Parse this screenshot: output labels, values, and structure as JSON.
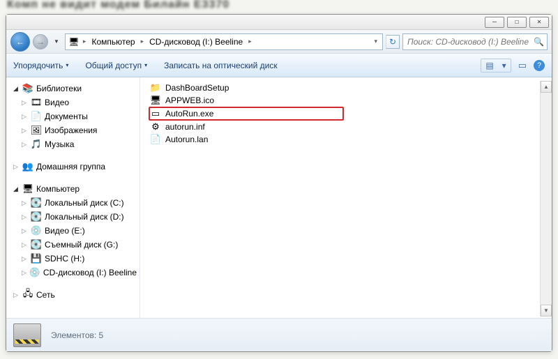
{
  "window_buttons": {
    "min": "—",
    "max": "☐",
    "close": "✕"
  },
  "nav": {
    "back_glyph": "←",
    "fwd_glyph": "→",
    "drop": "▼"
  },
  "breadcrumbs": {
    "root_icon": "🖥",
    "sep": "▸",
    "items": [
      "Компьютер",
      "CD-дисковод (I:) Beeline"
    ],
    "addr_drop": "▾",
    "refresh": "↻"
  },
  "search": {
    "placeholder": "Поиск: CD-дисковод (I:) Beeline",
    "icon": "🔍"
  },
  "toolbar": {
    "organize": "Упорядочить",
    "share": "Общий доступ",
    "burn": "Записать на оптический диск",
    "drop": "▾",
    "view_icon": "▤",
    "pane_icon": "▭",
    "help": "?"
  },
  "sidebar": {
    "libraries": {
      "label": "Библиотеки",
      "expander": "◢",
      "items": [
        {
          "icon": "🎞",
          "label": "Видео"
        },
        {
          "icon": "📄",
          "label": "Документы"
        },
        {
          "icon": "🖼",
          "label": "Изображения"
        },
        {
          "icon": "🎵",
          "label": "Музыка"
        }
      ]
    },
    "homegroup": {
      "label": "Домашняя группа",
      "icon": "👥"
    },
    "computer": {
      "label": "Компьютер",
      "expander": "◢",
      "icon": "🖥",
      "items": [
        {
          "icon": "💽",
          "label": "Локальный диск (C:)"
        },
        {
          "icon": "💽",
          "label": "Локальный диск (D:)"
        },
        {
          "icon": "💿",
          "label": "Видео (E:)"
        },
        {
          "icon": "💽",
          "label": "Съемный диск (G:)"
        },
        {
          "icon": "💾",
          "label": "SDHC (H:)"
        },
        {
          "icon": "💿",
          "label": "CD-дисковод (I:) Beeline"
        }
      ]
    },
    "network": {
      "label": "Сеть",
      "icon": "🖧"
    },
    "closed_expander": "▷"
  },
  "files": [
    {
      "icon": "📁",
      "name": "DashBoardSetup"
    },
    {
      "icon": "🖥",
      "name": "APPWEB.ico"
    },
    {
      "icon": "▭",
      "name": "AutoRun.exe",
      "highlight": true
    },
    {
      "icon": "⚙",
      "name": "autorun.inf"
    },
    {
      "icon": "📄",
      "name": "Autorun.lan"
    }
  ],
  "status": {
    "label": "Элементов: 5"
  },
  "scrollbar": {
    "up": "▲",
    "down": "▼"
  },
  "red_mark": "?"
}
